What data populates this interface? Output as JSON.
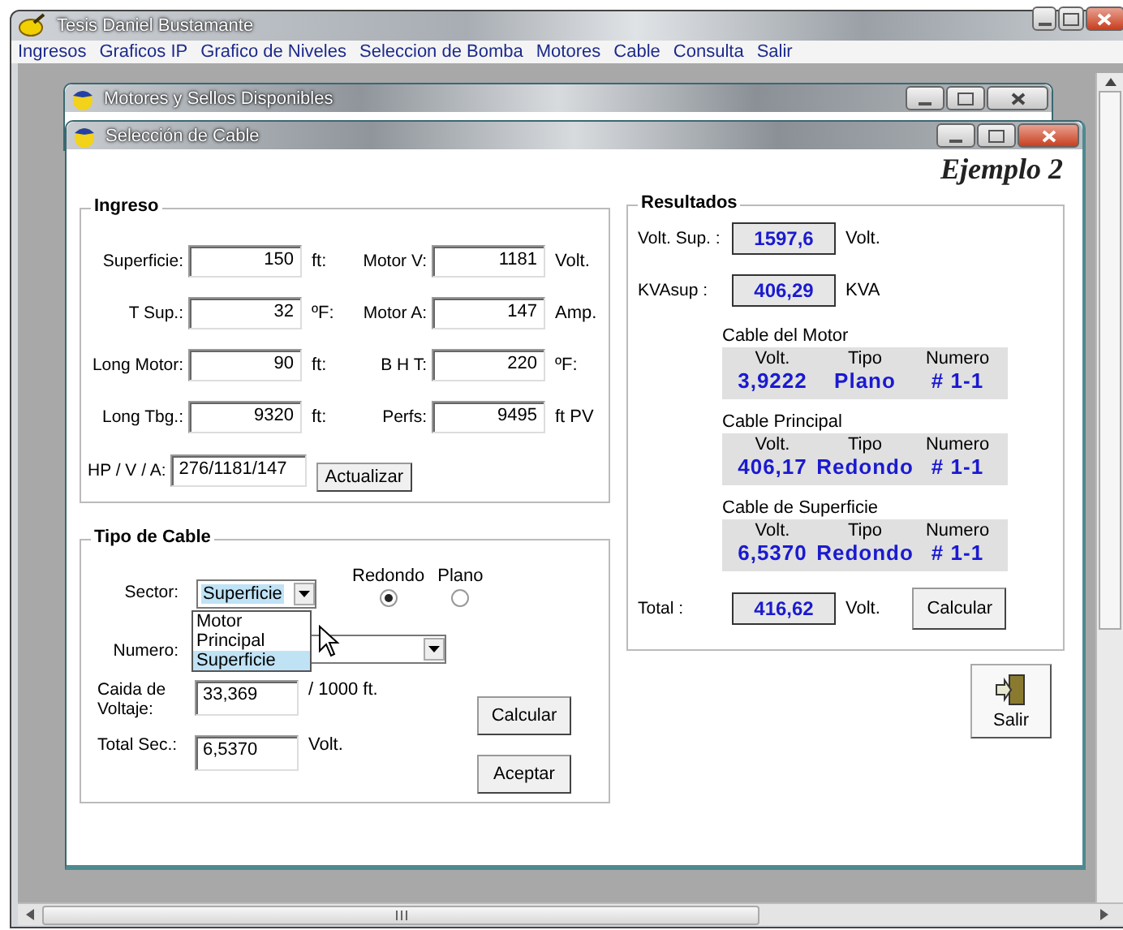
{
  "app_window": {
    "title": "Tesis Daniel Bustamante"
  },
  "menu": [
    {
      "label": "Ingresos"
    },
    {
      "label": "Graficos IP"
    },
    {
      "label": "Grafico de Niveles"
    },
    {
      "label": "Seleccion de Bomba"
    },
    {
      "label": "Motores"
    },
    {
      "label": "Cable"
    },
    {
      "label": "Consulta"
    },
    {
      "label": "Salir"
    }
  ],
  "background_window": {
    "title": "Motores y Sellos Disponibles"
  },
  "window": {
    "title": "Selección de Cable",
    "heading": "Ejemplo 2",
    "ingreso": {
      "title": "Ingreso",
      "fields": [
        {
          "label": "Superficie:",
          "value": "150",
          "unit": "ft:"
        },
        {
          "label": "Motor V:",
          "value": "1181",
          "unit": "Volt."
        },
        {
          "label": "T Sup.:",
          "value": "32",
          "unit": "ºF:"
        },
        {
          "label": "Motor A:",
          "value": "147",
          "unit": "Amp."
        },
        {
          "label": "Long Motor:",
          "value": "90",
          "unit": "ft:"
        },
        {
          "label": "B H T:",
          "value": "220",
          "unit": "ºF:"
        },
        {
          "label": "Long Tbg.:",
          "value": "9320",
          "unit": "ft:"
        },
        {
          "label": "Perfs:",
          "value": "9495",
          "unit": "ft PV"
        }
      ],
      "hp": {
        "label": "HP / V / A:",
        "value": "276/1181/147"
      },
      "button": "Actualizar"
    },
    "tipo_de_cable": {
      "title": "Tipo de Cable",
      "sector": {
        "label": "Sector:",
        "value": "Superficie",
        "expanded": true,
        "options": [
          {
            "label": "Motor",
            "selected": false
          },
          {
            "label": "Principal",
            "selected": false
          },
          {
            "label": "Superficie",
            "selected": true
          }
        ]
      },
      "radios": [
        {
          "label": "Redondo",
          "selected": true
        },
        {
          "label": "Plano",
          "selected": false
        }
      ],
      "numero": {
        "label": "Numero:"
      },
      "caida": {
        "label": "Caida de Voltaje:",
        "value": "33,369",
        "unit": "/ 1000 ft."
      },
      "total_sec": {
        "label": "Total Sec.:",
        "value": "6,5370",
        "unit": "Volt."
      },
      "buttons": [
        "Calcular",
        "Aceptar"
      ]
    },
    "resultados": {
      "title": "Resultados",
      "readings": [
        {
          "label": "Volt. Sup. :",
          "value": "1597,6",
          "unit": "Volt."
        },
        {
          "label": "KVAsup :",
          "value": "406,29",
          "unit": "KVA"
        }
      ],
      "cables": [
        {
          "title": "Cable del Motor",
          "headers": [
            "Volt.",
            "Tipo",
            "Numero"
          ],
          "volt": "3,9222",
          "tipo": "Plano",
          "numero": "# 1-1"
        },
        {
          "title": "Cable Principal",
          "headers": [
            "Volt.",
            "Tipo",
            "Numero"
          ],
          "volt": "406,17",
          "tipo": "Redondo",
          "numero": "# 1-1"
        },
        {
          "title": "Cable de Superficie",
          "headers": [
            "Volt.",
            "Tipo",
            "Numero"
          ],
          "volt": "6,5370",
          "tipo": "Redondo",
          "numero": "# 1-1"
        }
      ],
      "total": {
        "label": "Total :",
        "value": "416,62",
        "unit": "Volt."
      },
      "button": "Calcular"
    },
    "exit_button": "Salir"
  }
}
